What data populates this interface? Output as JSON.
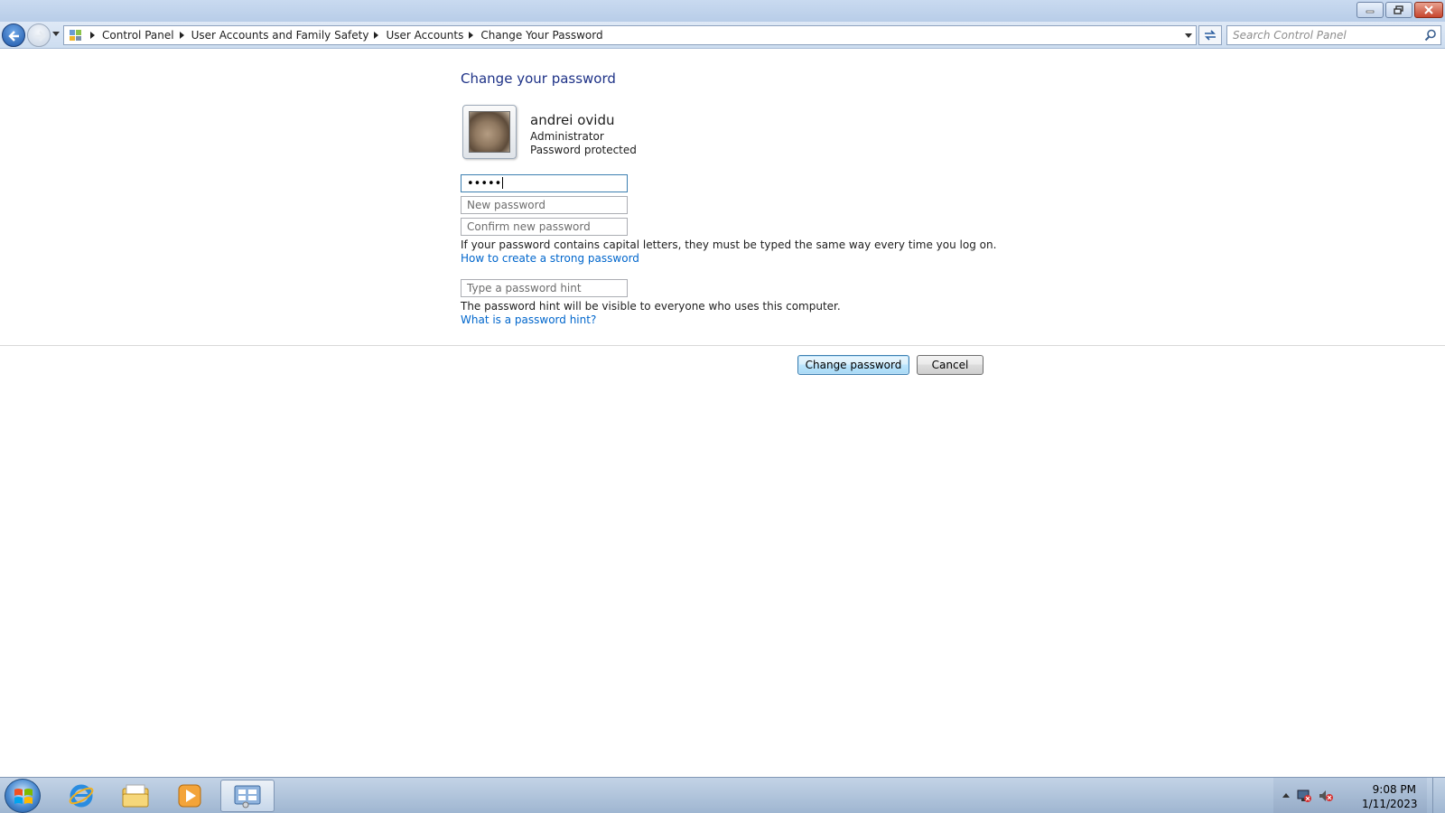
{
  "window": {
    "minimize_icon": "minimize-icon",
    "restore_icon": "restore-icon",
    "close_icon": "close-icon"
  },
  "nav": {
    "breadcrumbs": [
      "Control Panel",
      "User Accounts and Family Safety",
      "User Accounts",
      "Change Your Password"
    ],
    "search_placeholder": "Search Control Panel"
  },
  "page": {
    "title": "Change your password",
    "user": {
      "name": "andrei ovidu",
      "role": "Administrator",
      "status": "Password protected"
    },
    "current_password_value": "•••••",
    "new_password_placeholder": "New password",
    "confirm_password_placeholder": "Confirm new password",
    "caps_info": "If your password contains capital letters, they must be typed the same way every time you log on.",
    "strong_password_link": "How to create a strong password",
    "hint_placeholder": "Type a password hint",
    "hint_info": "The password hint will be visible to everyone who uses this computer.",
    "hint_link": "What is a password hint?",
    "change_button": "Change password",
    "cancel_button": "Cancel"
  },
  "taskbar": {
    "apps": [
      "internet-explorer-icon",
      "windows-explorer-icon",
      "media-player-icon",
      "control-panel-icon"
    ],
    "clock_time": "9:08 PM",
    "clock_date": "1/11/2023"
  },
  "colors": {
    "title_blue": "#1e3287",
    "link_blue": "#0066cc",
    "focus_border": "#3c7fb1"
  }
}
